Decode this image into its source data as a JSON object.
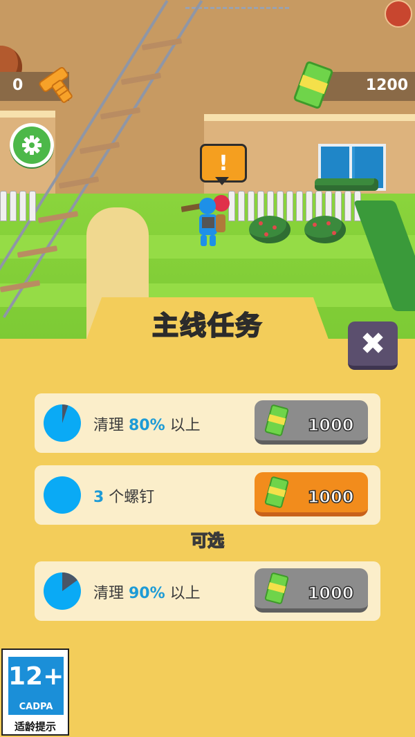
{
  "hud": {
    "bolt_count": "0",
    "bolt_icon": "bolt-icon",
    "money_count": "1200",
    "money_icon": "cash-icon",
    "settings_icon": "gear-icon"
  },
  "scene": {
    "alert_symbol": "!"
  },
  "quest_panel": {
    "title": "主线任务",
    "close_symbol": "✖",
    "tasks": [
      {
        "prefix": "清理 ",
        "highlight": "80%",
        "suffix": " 以上",
        "progress": 0.05,
        "reward": "1000",
        "state": "locked"
      },
      {
        "prefix": "",
        "highlight": "3",
        "suffix": " 个螺钉",
        "progress": 1.0,
        "reward": "1000",
        "state": "claimable"
      }
    ],
    "optional_label": "可选",
    "optional_tasks": [
      {
        "prefix": "清理 ",
        "highlight": "90%",
        "suffix": " 以上",
        "progress": 0.15,
        "reward": "1000",
        "state": "locked"
      }
    ]
  },
  "age_rating": {
    "age": "12+",
    "org": "CADPA",
    "hint": "适龄提示"
  },
  "colors": {
    "panel": "#f3cd5a",
    "highlight": "#1d9bd6",
    "claim_button": "#f28c1c",
    "locked_button": "#8c8c8c",
    "pie_fill": "#0aaaf5",
    "pie_done": "#4a5566"
  }
}
